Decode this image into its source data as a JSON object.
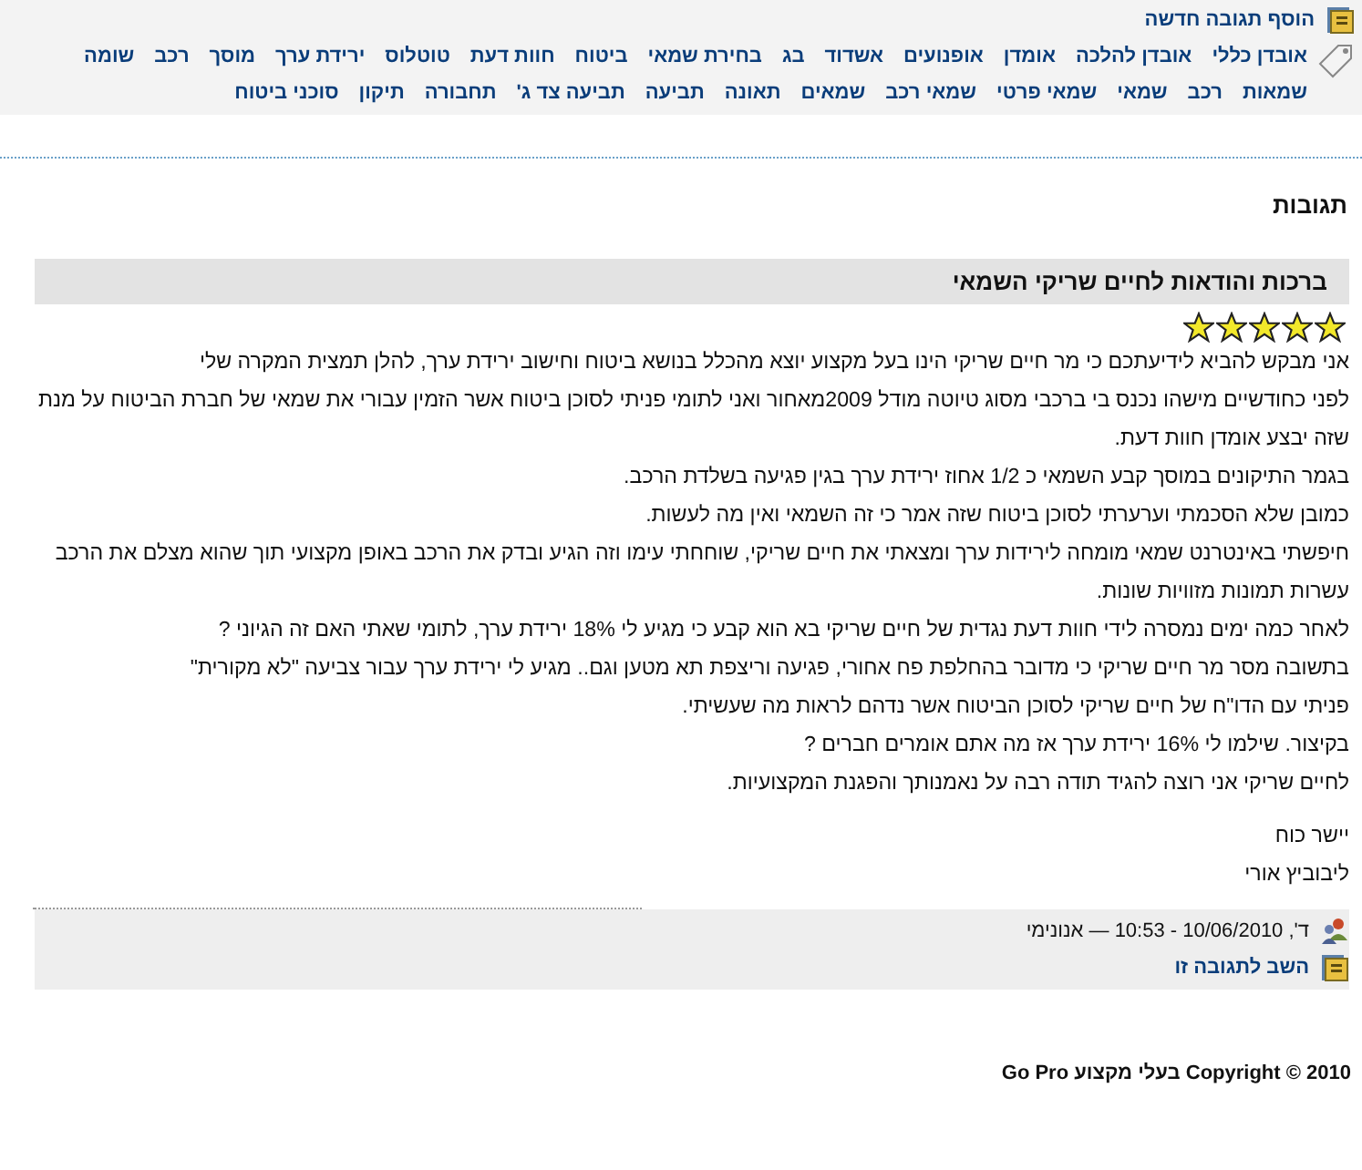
{
  "add_reply_link": "הוסף תגובה חדשה",
  "tags": [
    "אובדן כללי",
    "אובדן להלכה",
    "אומדן",
    "אופנועים",
    "אשדוד",
    "בג",
    "בחירת שמאי",
    "ביטוח",
    "חוות דעת",
    "טוטלוס",
    "ירידת ערך",
    "מוסך",
    "רכב",
    "שומה",
    "שמאות",
    "רכב",
    "שמאי",
    "שמאי פרטי",
    "שמאי רכב",
    "שמאים",
    "תאונה",
    "תביעה",
    "תביעה צד ג'",
    "תחבורה",
    "תיקון",
    "סוכני ביטוח"
  ],
  "comments_heading": "תגובות",
  "comment": {
    "title": "ברכות והודאות לחיים שריקי השמאי",
    "stars": 5,
    "paragraphs": [
      "אני מבקש להביא לידיעתכם כי מר חיים שריקי הינו בעל מקצוע יוצא מהכלל בנושא ביטוח וחישוב ירידת ערך, להלן תמצית המקרה שלי",
      "לפני כחודשיים מישהו נכנס בי ברכבי מסוג טיוטה מודל 2009מאחור ואני לתומי פניתי לסוכן ביטוח אשר הזמין עבורי את שמאי של חברת הביטוח על מנת שזה יבצע אומדן חוות דעת.",
      "בגמר התיקונים במוסך קבע השמאי כ 1/2 אחוז ירידת ערך בגין פגיעה בשלדת הרכב.",
      "כמובן שלא הסכמתי וערערתי לסוכן ביטוח שזה אמר כי  זה השמאי ואין מה לעשות.",
      "חיפשתי באינטרנט שמאי מומחה לירידות ערך ומצאתי את חיים שריקי, שוחחתי עימו וזה הגיע ובדק את הרכב באופן מקצועי תוך שהוא מצלם את הרכב עשרות תמונות מזוויות שונות.",
      "לאחר כמה ימים נמסרה לידי חוות דעת נגדית של חיים שריקי בא הוא קבע כי מגיע לי 18% ירידת ערך, לתומי שאתי האם זה הגיוני ?",
      "בתשובה מסר מר חיים שריקי כי מדובר בהחלפת פח אחורי, פגיעה וריצפת תא מטען וגם.. מגיע לי ירידת ערך עבור צביעה \"לא מקורית\"",
      "פניתי עם הדו\"ח של חיים שריקי לסוכן הביטוח אשר נדהם לראות מה שעשיתי.",
      "בקיצור.  שילמו לי   16% ירידת ערך  אז מה אתם אומרים חברים ?",
      "לחיים שריקי אני רוצה להגיד תודה רבה על נאמנותך והפגנת המקצועיות."
    ],
    "signature": [
      "יישר כוח",
      "ליבוביץ אורי"
    ],
    "meta": "ד', 10/06/2010 - 10:53 — אנונימי",
    "reply_link": "השב לתגובה זו"
  },
  "copyright": "Go Pro בעלי מקצוע Copyright © 2010"
}
